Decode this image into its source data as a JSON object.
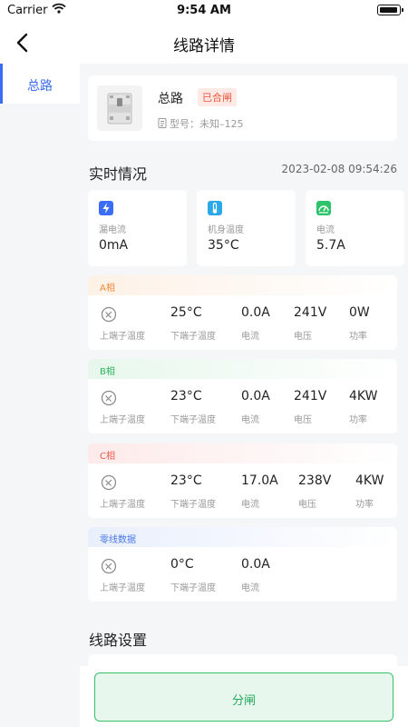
{
  "status_bar": {
    "carrier": "Carrier",
    "time": "9:54 AM"
  },
  "nav": {
    "title": "线路详情"
  },
  "sidebar": {
    "items": [
      {
        "label": "总路",
        "active": true
      }
    ]
  },
  "device": {
    "name": "总路",
    "status": "已合闸",
    "model_label": "型号：",
    "model_value": "未知–125"
  },
  "realtime": {
    "title": "实时情况",
    "timestamp": "2023-02-08 09:54:26",
    "metrics": [
      {
        "icon": "lightning-icon",
        "color": "#3a6cf4",
        "label": "漏电流",
        "value": "0mA"
      },
      {
        "icon": "thermometer-icon",
        "color": "#2aa8e8",
        "label": "机身温度",
        "value": "35°C"
      },
      {
        "icon": "current-icon",
        "color": "#2dc36a",
        "label": "电流",
        "value": "5.7A"
      }
    ]
  },
  "phases": [
    {
      "title": "A相",
      "title_color": "#f08a3a",
      "head_color": "#fdf1e6",
      "cells": [
        {
          "value": "",
          "label": "上端子温度"
        },
        {
          "value": "25°C",
          "label": "下端子温度"
        },
        {
          "value": "0.0A",
          "label": "电流"
        },
        {
          "value": "241V",
          "label": "电压"
        },
        {
          "value": "0W",
          "label": "功率"
        }
      ]
    },
    {
      "title": "B相",
      "title_color": "#2bb35a",
      "head_color": "#e7f7ec",
      "cells": [
        {
          "value": "",
          "label": "上端子温度"
        },
        {
          "value": "23°C",
          "label": "下端子温度"
        },
        {
          "value": "0.0A",
          "label": "电流"
        },
        {
          "value": "241V",
          "label": "电压"
        },
        {
          "value": "4KW",
          "label": "功率"
        }
      ]
    },
    {
      "title": "C相",
      "title_color": "#ee5a48",
      "head_color": "#fdeaea",
      "cells": [
        {
          "value": "",
          "label": "上端子温度"
        },
        {
          "value": "23°C",
          "label": "下端子温度"
        },
        {
          "value": "17.0A",
          "label": "电流"
        },
        {
          "value": "238V",
          "label": "电压"
        },
        {
          "value": "4KW",
          "label": "功率"
        }
      ]
    },
    {
      "title": "零线数据",
      "title_color": "#4a76e8",
      "head_color": "#e9effc",
      "cells": [
        {
          "value": "",
          "label": "上端子温度"
        },
        {
          "value": "0°C",
          "label": "下端子温度"
        },
        {
          "value": "0.0A",
          "label": "电流"
        }
      ]
    }
  ],
  "settings": {
    "title": "线路设置"
  },
  "actions": {
    "switch_label": "分闸"
  }
}
